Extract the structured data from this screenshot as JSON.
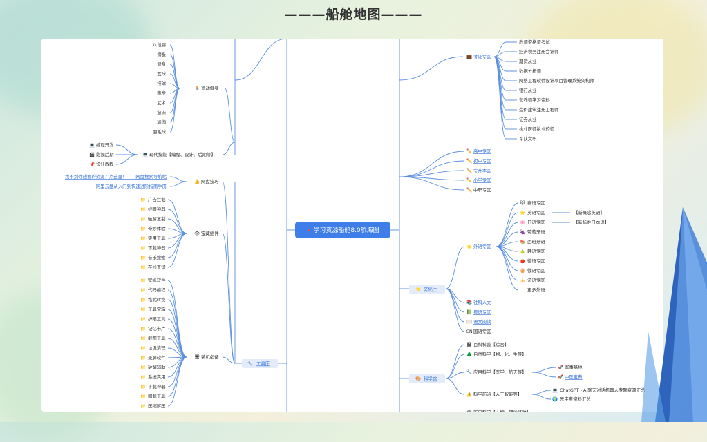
{
  "page": {
    "title": "———船舱地图———"
  },
  "root": {
    "icon": "🔺",
    "label": "学习资源船舱8.0航海图"
  },
  "left": {
    "sports": {
      "icon": "🏃",
      "label": "运动健身",
      "items": [
        "八段锦",
        "滑板",
        "健身",
        "篮球",
        "排球",
        "跑步",
        "武术",
        "游泳",
        "瑜伽",
        "羽毛球"
      ]
    },
    "skills": {
      "icon": "💻",
      "label": "现代技能【编程、设计、后期等】",
      "items": [
        {
          "icon": "💻",
          "label": "编程开发"
        },
        {
          "icon": "🎬",
          "label": "影视后期"
        },
        {
          "icon": "📌",
          "label": "设计教程"
        }
      ]
    },
    "netdisk": {
      "icon": "👍",
      "label": "网盘技巧",
      "items": [
        "找不到你想要的资源？点这里！——网盘搜索导航站",
        "阿里云盘从入门到快速进阶指南手册"
      ]
    },
    "plugins": {
      "icon": "👁",
      "label": "宝藏插件",
      "items": [
        "广告拦截",
        "护眼神器",
        "破解复制",
        "奇妙体验",
        "实用工具",
        "下载神器",
        "音乐搜索",
        "在线查词"
      ]
    },
    "essentials": {
      "icon": "🖥",
      "label": "装机必备",
      "items": [
        "壁纸软件",
        "代码编程",
        "格式转换",
        "工具宝箱",
        "护眼工具",
        "记忆卡片",
        "截图工具",
        "垃圾清理",
        "录屏软件",
        "破解辅助",
        "系统实用",
        "下载神器",
        "卸载工具",
        "压缩解压"
      ]
    },
    "toolbox": {
      "icon": "🔧",
      "label": "工具库"
    }
  },
  "right": {
    "exam": {
      "icon": "💼",
      "label": "考证专区",
      "items": [
        "教师资格证考试",
        "经济税务注册会计师",
        "期货从业",
        "数据分析师",
        "网络工程软件设计项目管理系统架构师",
        "银行从业",
        "营养师学习资料",
        "造价建筑注册工程师",
        "证券从业",
        "执业医师执业药师",
        "军队文职"
      ]
    },
    "school": [
      {
        "icon": "✏️",
        "label": "高中专区",
        "link": true
      },
      {
        "icon": "✏️",
        "label": "初中专区",
        "link": true
      },
      {
        "icon": "✏️",
        "label": "专升本区",
        "link": true
      },
      {
        "icon": "✏️",
        "label": "小学专区",
        "link": true
      },
      {
        "icon": "✏️",
        "label": "中职专区",
        "link": false
      }
    ],
    "foreign": {
      "icon": "⭐",
      "label": "外语专区",
      "items": [
        {
          "icon": "🐱",
          "label": "泰语专区"
        },
        {
          "icon": "⭐",
          "label": "英语专区",
          "extra": "【新概念英语】"
        },
        {
          "icon": "🌸",
          "label": "日语专区",
          "extra": "【新标准日本语】"
        },
        {
          "icon": "🍇",
          "label": "葡萄牙语"
        },
        {
          "icon": "🍉",
          "label": "西班牙语"
        },
        {
          "icon": "🍐",
          "label": "韩语专区"
        },
        {
          "icon": "🍅",
          "label": "德语专区"
        },
        {
          "icon": "🥚",
          "label": "俄语专区"
        },
        {
          "icon": "🍌",
          "label": "法语专区"
        },
        {
          "icon": "",
          "label": "更多外语"
        }
      ]
    },
    "culture": {
      "icon": "⭐",
      "label": "文化厅"
    },
    "culture_more": [
      {
        "icon": "📚",
        "label": "社科人文",
        "link": true
      },
      {
        "icon": "📗",
        "label": "粤语专区",
        "link": true
      },
      {
        "icon": "📖",
        "label": "语文阅读",
        "link": true
      },
      {
        "icon": "CN",
        "label": "国语专区",
        "link": false
      }
    ],
    "science": {
      "icon": "🎨",
      "label": "科学馆",
      "items": [
        {
          "icon": "📓",
          "label": "百科科普【综合】"
        },
        {
          "icon": "🌲",
          "label": "自然科学【物、化、生等】"
        },
        {
          "icon": "🔧",
          "label": "应用科学【医学、航天等】"
        },
        {
          "icon": "⚠️",
          "label": "科学前沿【人工智能等】"
        }
      ],
      "applied_sub": [
        {
          "icon": "🚀",
          "label": "军事基地",
          "link": false
        },
        {
          "icon": "🚀",
          "label": "中医宝典",
          "link": true
        }
      ],
      "frontier_sub": [
        {
          "icon": "💻",
          "label": "ChatGPT - AI聊天对话机器人专题资源汇总"
        },
        {
          "icon": "🌍",
          "label": "元宇宙资料汇总"
        }
      ],
      "bottom_cut": "历史科学【人物、理论经验】"
    }
  },
  "colors": {
    "accent": "#3f7ee8",
    "line": "#5b8fe0",
    "link": "#2f6fd6"
  }
}
